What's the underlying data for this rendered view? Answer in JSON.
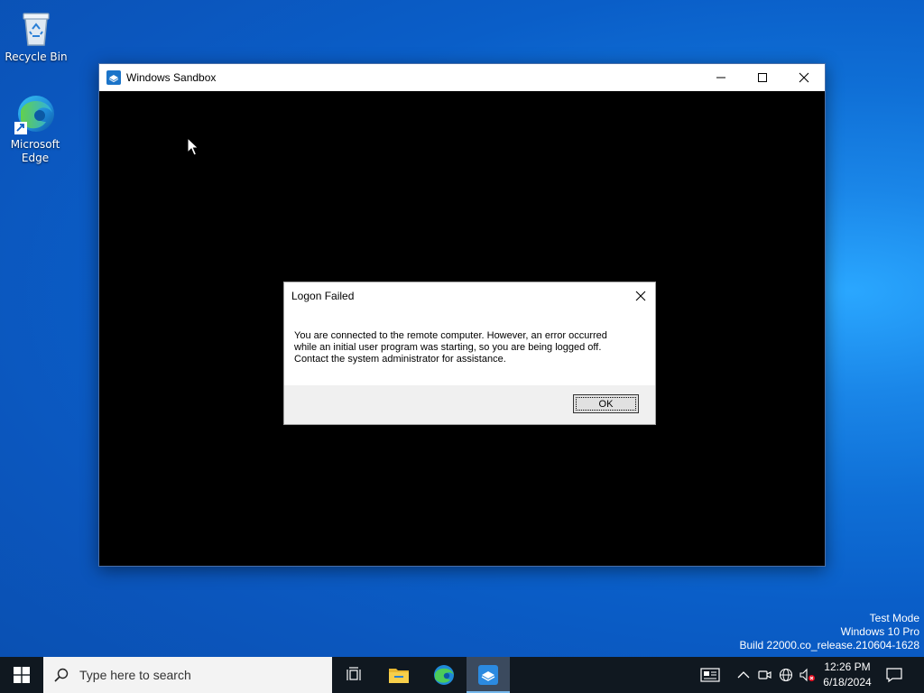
{
  "desktop": {
    "icons": [
      {
        "label": "Recycle Bin",
        "icon": "recycle-bin-icon"
      },
      {
        "label_line1": "Microsoft",
        "label_line2": "Edge",
        "icon": "edge-icon"
      }
    ]
  },
  "window": {
    "title": "Windows Sandbox",
    "icon": "sandbox-icon",
    "controls": [
      "minimize-icon",
      "maximize-icon",
      "close-icon"
    ]
  },
  "dialog": {
    "title": "Logon Failed",
    "message_lines": [
      "You are connected to the remote computer. However, an error occurred",
      "while an initial user program was starting, so you are being logged off.",
      "Contact the system administrator for assistance."
    ],
    "ok_label": "OK"
  },
  "watermark": {
    "line1": "Test Mode",
    "line2": "Windows 10 Pro",
    "line3": "Build 22000.co_release.210604-1628"
  },
  "taskbar": {
    "search_placeholder": "Type here to search",
    "pinned": [
      "task-view-icon",
      "file-explorer-icon",
      "edge-icon",
      "sandbox-icon"
    ],
    "tray": [
      "news-icon",
      "chevron-up-icon",
      "meet-icon",
      "network-icon",
      "volume-muted-icon"
    ],
    "clock": {
      "time": "12:26 PM",
      "date": "6/18/2024"
    }
  },
  "colors": {
    "taskbar": "#101820",
    "desktop_accent": "#0f6fd6",
    "active_indicator": "#76b9ed"
  }
}
